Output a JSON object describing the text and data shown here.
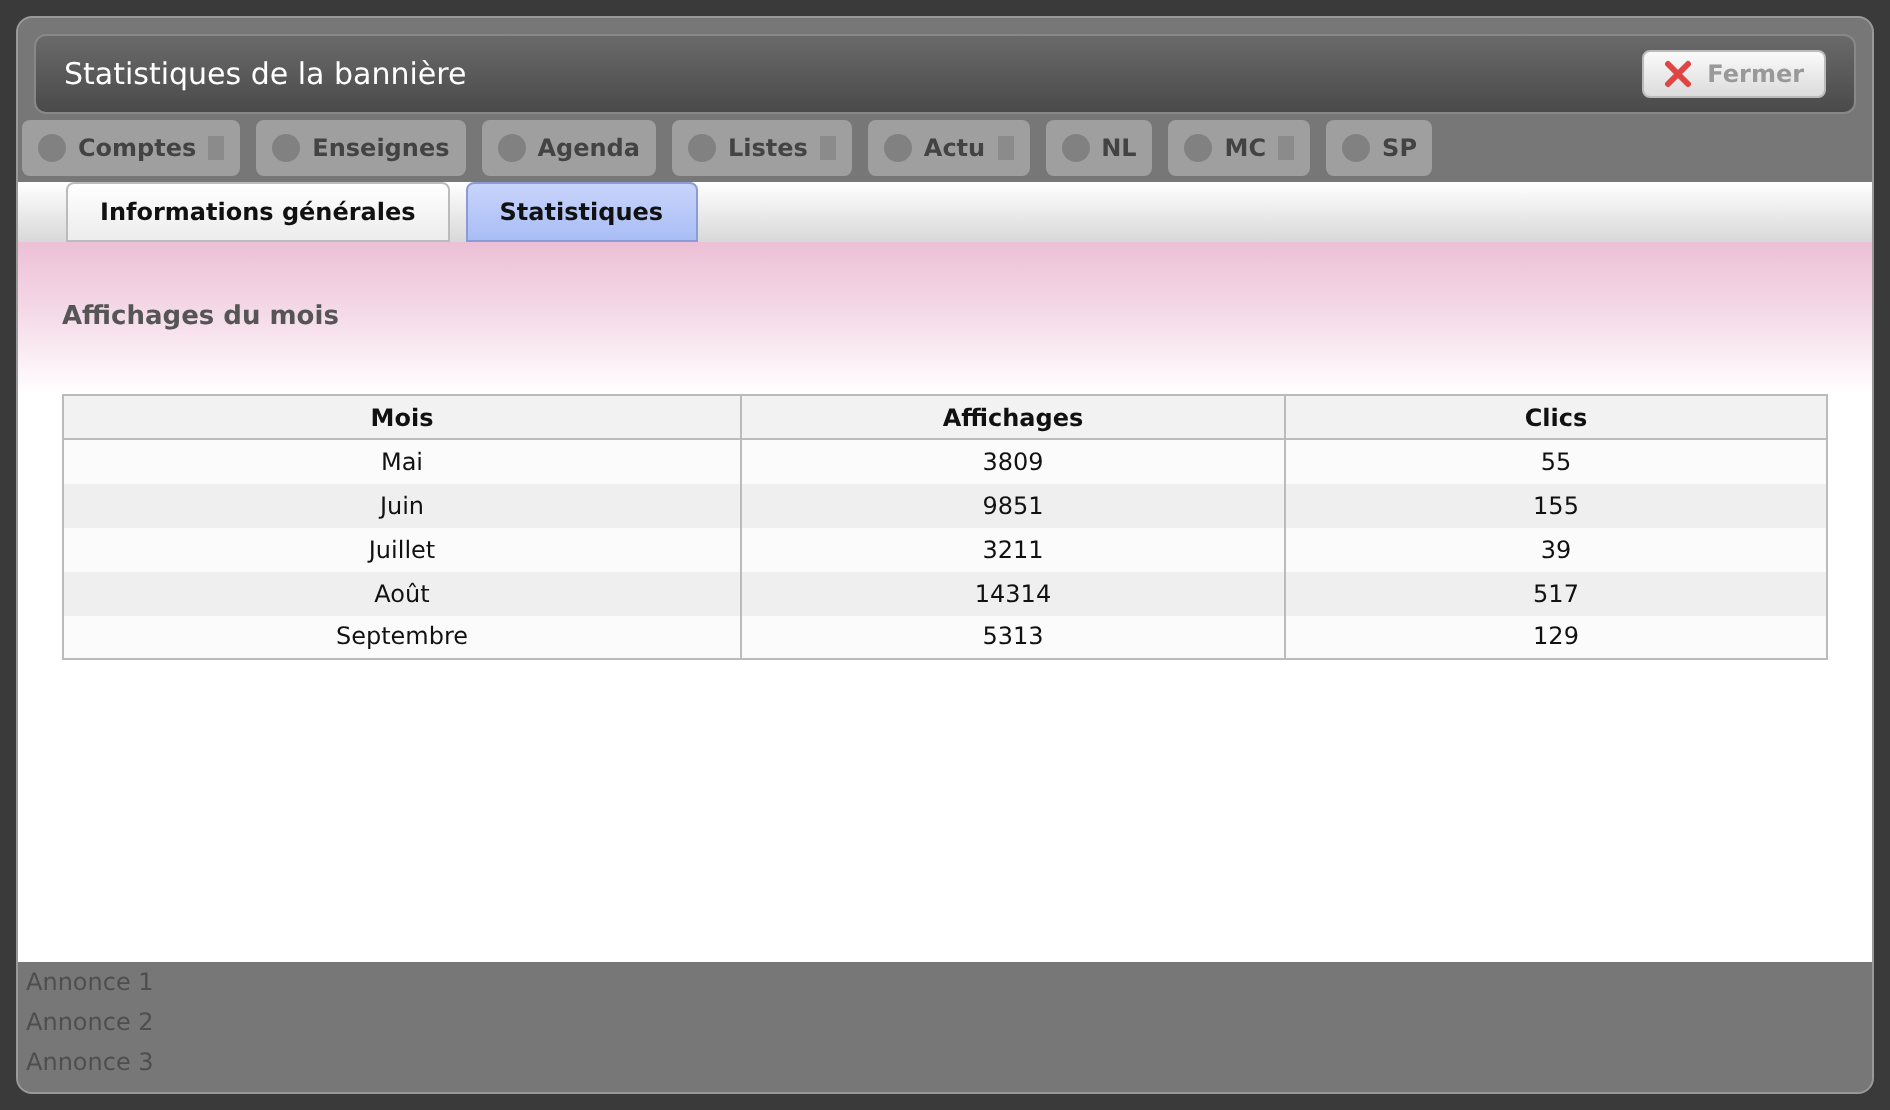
{
  "dialog": {
    "title": "Statistiques de la bannière",
    "close_button": "Fermer"
  },
  "background_nav": [
    {
      "label": "Comptes",
      "arrow": true
    },
    {
      "label": "Enseignes",
      "arrow": false
    },
    {
      "label": "Agenda",
      "arrow": false
    },
    {
      "label": "Listes",
      "arrow": true
    },
    {
      "label": "Actu",
      "arrow": true
    },
    {
      "label": "NL",
      "arrow": false
    },
    {
      "label": "MC",
      "arrow": true
    },
    {
      "label": "SP",
      "arrow": false
    }
  ],
  "tabs": [
    {
      "label": "Informations générales",
      "selected": false
    },
    {
      "label": "Statistiques",
      "selected": true
    }
  ],
  "section_title": "Affichages du mois",
  "table": {
    "columns": [
      "Mois",
      "Affichages",
      "Clics"
    ],
    "rows": [
      [
        "Mai",
        "3809",
        "55"
      ],
      [
        "Juin",
        "9851",
        "155"
      ],
      [
        "Juillet",
        "3211",
        "39"
      ],
      [
        "Août",
        "14314",
        "517"
      ],
      [
        "Septembre",
        "5313",
        "129"
      ]
    ]
  },
  "background_list": [
    "Annonce 1",
    "Annonce 2",
    "Annonce 3"
  ]
}
